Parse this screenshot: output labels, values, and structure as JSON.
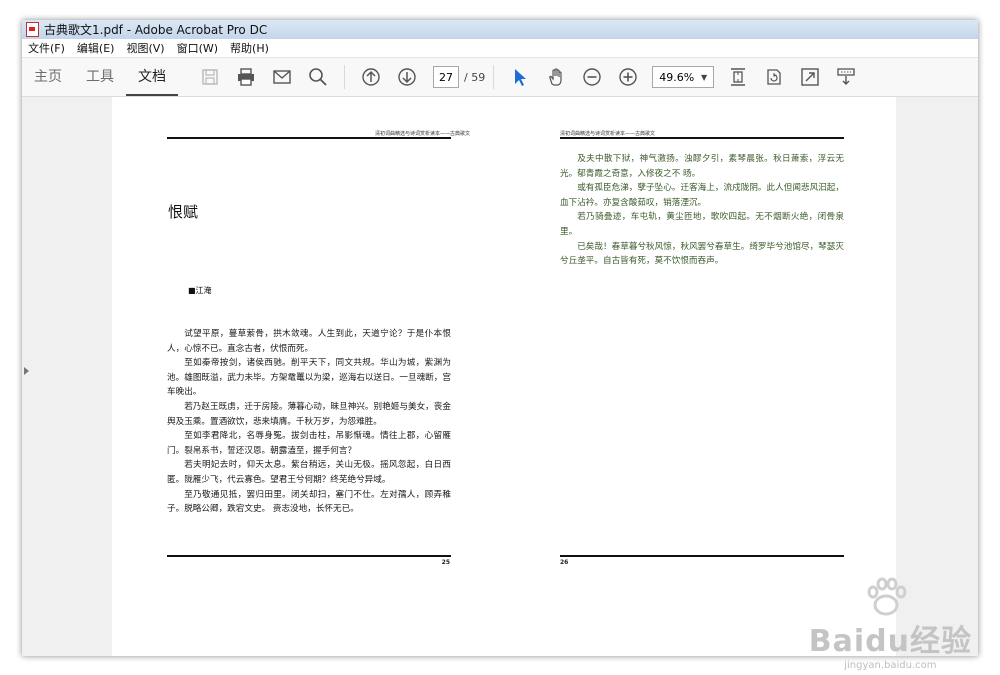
{
  "window": {
    "title": "古典歌文1.pdf - Adobe Acrobat Pro DC"
  },
  "menu": [
    "文件(F)",
    "编辑(E)",
    "视图(V)",
    "窗口(W)",
    "帮助(H)"
  ],
  "toolbar": {
    "tabs": [
      "主页",
      "工具",
      "文档"
    ],
    "active_tab": "文档",
    "page_current": "27",
    "page_total": "/ 59",
    "zoom": "49.6%"
  },
  "icons": [
    "save-icon",
    "print-icon",
    "email-icon",
    "search-icon",
    "page-up-icon",
    "page-down-icon",
    "select-arrow-icon",
    "hand-tool-icon",
    "zoom-out-icon",
    "zoom-in-icon",
    "fit-page-icon",
    "rotate-icon",
    "full-screen-icon",
    "read-mode-icon"
  ],
  "left_page": {
    "header": "清初词曲精选与诗词赏析读本——古典歌文",
    "title": "恨赋",
    "author": "■江淹",
    "paragraphs": [
      "试望平原，蔓草萦骨，拱木敛魂。人生到此，天道宁论？于是仆本恨人，心惊不已。直念古者，伏恨而死。",
      "至如秦帝按剑，诸侯西驰。削平天下，同文共规。华山为城，紫渊为池。雄图既溢，武力未毕。方架鼋鼍以为梁，巡海右以送日。一旦魂断，宫车晚出。",
      "若乃赵王既虏，迁于房陵。薄暮心动，昧旦神兴。别艳姬与美女，丧金舆及玉乘。置酒欲饮，悲来填膺。千秋万岁，为怨难胜。",
      "至如李君降北，名辱身冤。拔剑击柱，吊影惭魂。情往上郡，心留雁门。裂帛系书，誓还汉恩。朝露溘至，握手何言？",
      "若夫明妃去时，仰天太息。紫台稍远，关山无极。摇风忽起，白日西匿。陇雁少飞，代云寡色。望君王兮何期？终芜绝兮异域。",
      "至乃敬通见抵，罢归田里。闭关却扫，塞门不仕。左对孺人，顾弄稚子。脱略公卿，跌宕文史。 赍志没地，长怀无已。"
    ],
    "page_number": "25"
  },
  "right_page": {
    "header": "清初词曲精选与诗词赏析读本——古典歌文",
    "paragraphs": [
      "及夫中散下狱，神气激扬。浊醪夕引，素琴晨张。秋日萧索，浮云无光。郁青霞之奇意，入修夜之不 旸。",
      "或有孤臣危涕，孽子坠心。迁客海上，流戍陇阴。此人但闻悲风汩起，血下沾衿。亦复含酸茹叹，销落湮沉。",
      "若乃骑叠迹，车屯轨，黄尘匝地，歌吹四起。无不烟断火绝，闭骨泉里。",
      "已矣哉！春草暮兮秋风惊，秋风罢兮春草生。绮罗毕兮池馆尽，琴瑟灭兮丘垄平。自古皆有死，莫不饮恨而吞声。"
    ],
    "page_number": "26"
  },
  "watermark": {
    "main": "Baidu经验",
    "sub": "jingyan.baidu.com"
  }
}
